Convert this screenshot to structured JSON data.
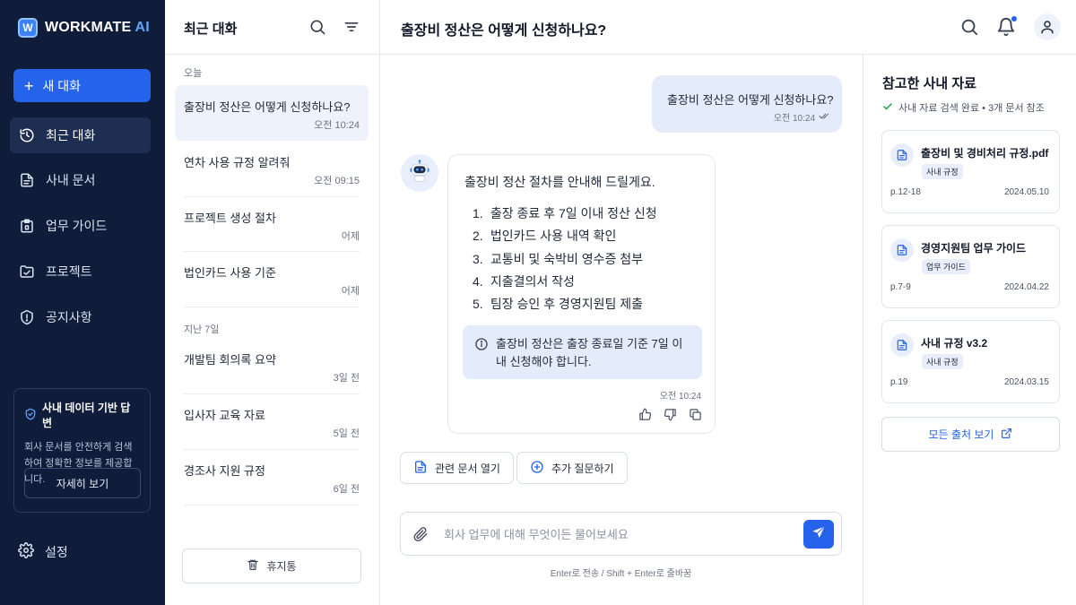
{
  "app": {
    "logo_mark": "W",
    "name": "WORKMATE",
    "name_suffix": "AI",
    "accent_color": "#2563eb",
    "sidebar_bg": "#0f1c3a"
  },
  "sidebar": {
    "new_chat_label": "새 대화",
    "items": [
      {
        "label": "최근 대화",
        "icon": "history-icon",
        "active": true
      },
      {
        "label": "사내 문서",
        "icon": "document-icon",
        "active": false
      },
      {
        "label": "업무 가이드",
        "icon": "guide-icon",
        "active": false
      },
      {
        "label": "프로젝트",
        "icon": "folder-icon",
        "active": false
      },
      {
        "label": "공지사항",
        "icon": "notice-icon",
        "active": false
      }
    ],
    "info_box": {
      "title": "사내 데이터 기반 답변",
      "description": "회사 문서를 안전하게 검색하여 정확한 정보를 제공합니다.",
      "button_label": "자세히 보기"
    },
    "settings_label": "설정"
  },
  "history": {
    "title": "최근 대화",
    "group_today": "오늘",
    "group_week": "지난 7일",
    "today": [
      {
        "title": "출장비 정산은 어떻게 신청하나요?",
        "time": "오전 10:24"
      },
      {
        "title": "연차 사용 규정 알려줘",
        "time": "오전 09:15"
      },
      {
        "title": "프로젝트 생성 절차",
        "time": "어제"
      },
      {
        "title": "법인카드 사용 기준",
        "time": "어제"
      }
    ],
    "week": [
      {
        "title": "개발팀 회의록 요약",
        "time": "3일 전"
      },
      {
        "title": "입사자 교육 자료",
        "time": "5일 전"
      },
      {
        "title": "경조사 지원 규정",
        "time": "6일 전"
      }
    ],
    "trash_label": "휴지통"
  },
  "chat": {
    "title": "출장비 정산은 어떻게 신청하나요?",
    "user_message": {
      "text": "출장비 정산은 어떻게 신청하나요?",
      "time": "오전 10:24"
    },
    "bot_message": {
      "intro": "출장비 정산 절차를 안내해 드릴게요.",
      "steps": [
        {
          "n": "1.",
          "text": "출장 종료 후 7일 이내 정산 신청"
        },
        {
          "n": "2.",
          "text": "법인카드 사용 내역 확인"
        },
        {
          "n": "3.",
          "text": "교통비 및 숙박비 영수증 첨부"
        },
        {
          "n": "4.",
          "text": "지출결의서 작성"
        },
        {
          "n": "5.",
          "text": "팀장 승인 후 경영지원팀 제출"
        }
      ],
      "notice": "출장비 정산은 출장 종료일 기준 7일 이내 신청해야 합니다.",
      "time": "오전 10:24"
    },
    "actions": {
      "open_doc": "관련 문서 열기",
      "ask_more": "추가 질문하기"
    },
    "composer": {
      "placeholder": "회사 업무에 대해 무엇이든 물어보세요",
      "value": "",
      "hint": "Enter로 전송 / Shift + Enter로 줄바꿈"
    }
  },
  "sources": {
    "title": "참고한 사내 자료",
    "status": "사내 자료 검색 완료 • 3개 문서 참조",
    "docs": [
      {
        "name": "출장비 및 경비처리 규정.pdf",
        "tag": "사내 규정",
        "pages": "p.12-18",
        "date": "2024.05.10"
      },
      {
        "name": "경영지원팀 업무 가이드",
        "tag": "업무 가이드",
        "pages": "p.7-9",
        "date": "2024.04.22"
      },
      {
        "name": "사내 규정 v3.2",
        "tag": "사내 규정",
        "pages": "p.19",
        "date": "2024.03.15"
      }
    ],
    "all_sources_label": "모든 출처 보기"
  }
}
